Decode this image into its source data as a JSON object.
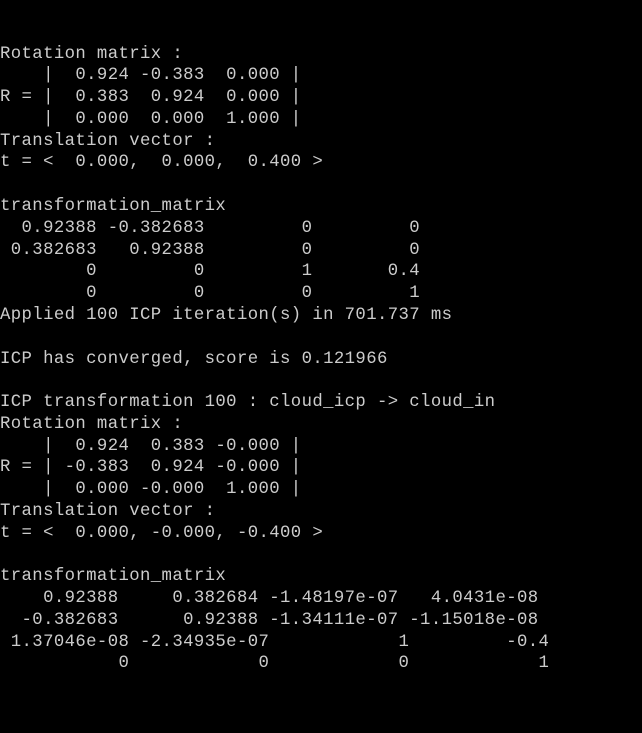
{
  "lines": [
    "Rotation matrix :",
    "    |  0.924 -0.383  0.000 |",
    "R = |  0.383  0.924  0.000 |",
    "    |  0.000  0.000  1.000 |",
    "Translation vector :",
    "t = <  0.000,  0.000,  0.400 >",
    "",
    "transformation_matrix",
    "  0.92388 -0.382683         0         0",
    " 0.382683   0.92388         0         0",
    "        0         0         1       0.4",
    "        0         0         0         1",
    "Applied 100 ICP iteration(s) in 701.737 ms",
    "",
    "ICP has converged, score is 0.121966",
    "",
    "ICP transformation 100 : cloud_icp -> cloud_in",
    "Rotation matrix :",
    "    |  0.924  0.383 -0.000 |",
    "R = | -0.383  0.924 -0.000 |",
    "    |  0.000 -0.000  1.000 |",
    "Translation vector :",
    "t = <  0.000, -0.000, -0.400 >",
    "",
    "transformation_matrix",
    "    0.92388     0.382684 -1.48197e-07   4.0431e-08",
    "  -0.382683      0.92388 -1.34111e-07 -1.15018e-08",
    " 1.37046e-08 -2.34935e-07            1         -0.4",
    "           0            0            0            1",
    "",
    "",
    ""
  ]
}
